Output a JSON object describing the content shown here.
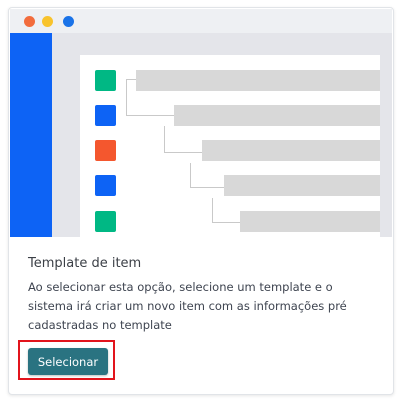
{
  "card": {
    "title": "Template de item",
    "description": "Ao selecionar esta opção, selecione um template e o sistema irá criar um novo item com as informações pré cadastradas no template",
    "select_button_label": "Selecionar"
  },
  "illustration": {
    "window_dot_colors": [
      "#f26c3c",
      "#f8c32c",
      "#1a73e8"
    ],
    "sidebar_color": "#0d63f5",
    "item_colors": [
      "#00b884",
      "#0d63f5",
      "#f4572e",
      "#0d63f5",
      "#00b884"
    ],
    "row_count": 5
  },
  "colors": {
    "button_background": "#2a7381",
    "highlight_border": "#e2141c"
  }
}
